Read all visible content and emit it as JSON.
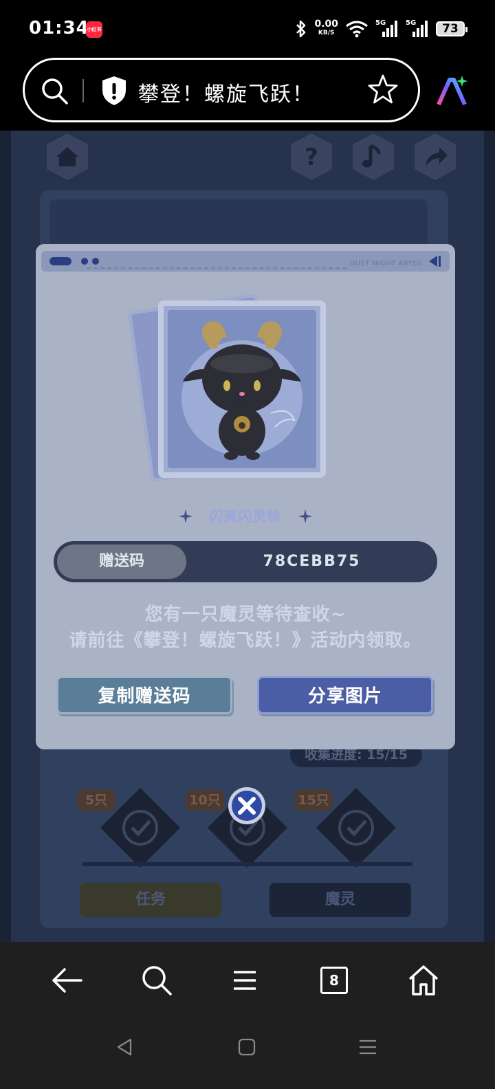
{
  "status_bar": {
    "time": "01:34",
    "app_badge": "小红书",
    "net_speed_value": "0.00",
    "net_speed_unit": "KB/S",
    "signal1_label": "5G",
    "signal2_label": "5G",
    "battery": "73"
  },
  "address_bar": {
    "page_title": "攀登！螺旋飞跃！"
  },
  "background": {
    "progress_text": "收集进度: 15/15",
    "milestones": [
      "5只",
      "10只",
      "15只"
    ],
    "tabs": [
      "任务",
      "魔灵"
    ]
  },
  "modal": {
    "header_brand": "DUET NIGHT ABYSS",
    "item_name": "闪亮闪灵铃",
    "code_label": "赠送码",
    "code_value": "78CEBB75",
    "message_line1": "您有一只魔灵等待查收~",
    "message_line2": "请前往《攀登！螺旋飞跃！》活动内领取。",
    "copy_button": "复制赠送码",
    "share_button": "分享图片"
  },
  "browser_nav": {
    "tab_count": "8"
  },
  "colors": {
    "modal_bg": "#aab2c6",
    "code_box": "#333c56",
    "copy_btn": "#5a7d98",
    "share_btn": "#4b5da4",
    "item_name": "#98a6de"
  },
  "icons": [
    "search-icon",
    "shield-icon",
    "star-icon",
    "ai-icon",
    "home-icon",
    "help-icon",
    "music-icon",
    "share-icon",
    "close-icon",
    "back-icon",
    "menu-icon",
    "tabs-icon"
  ]
}
